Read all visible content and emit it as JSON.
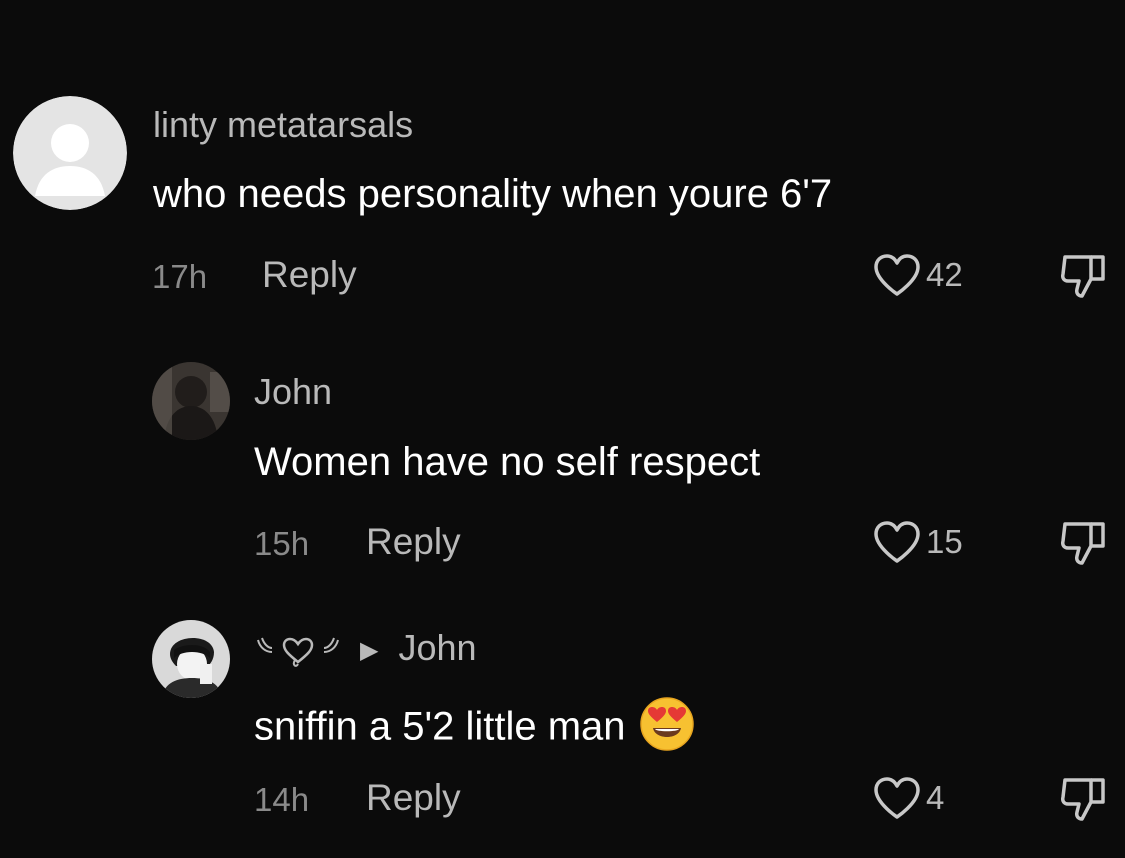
{
  "comments": [
    {
      "username": "linty metatarsals",
      "text": "who needs personality when youre 6'7",
      "time": "17h",
      "reply_label": "Reply",
      "likes": "42",
      "avatar": "default-avatar-icon"
    },
    {
      "username": "John",
      "text": "Women have no self respect",
      "time": "15h",
      "reply_label": "Reply",
      "likes": "15",
      "avatar": "user-photo-avatar"
    },
    {
      "reply_to": "John",
      "text": "sniffin a 5'2 little man",
      "emoji": "heart-eyes-emoji",
      "time": "14h",
      "reply_label": "Reply",
      "likes": "4",
      "avatar": "anime-avatar"
    }
  ],
  "colors": {
    "background": "#0b0b0b",
    "primary_text": "#ffffff",
    "secondary_text": "#b9b9b9",
    "muted_text": "#8a8a8a"
  }
}
